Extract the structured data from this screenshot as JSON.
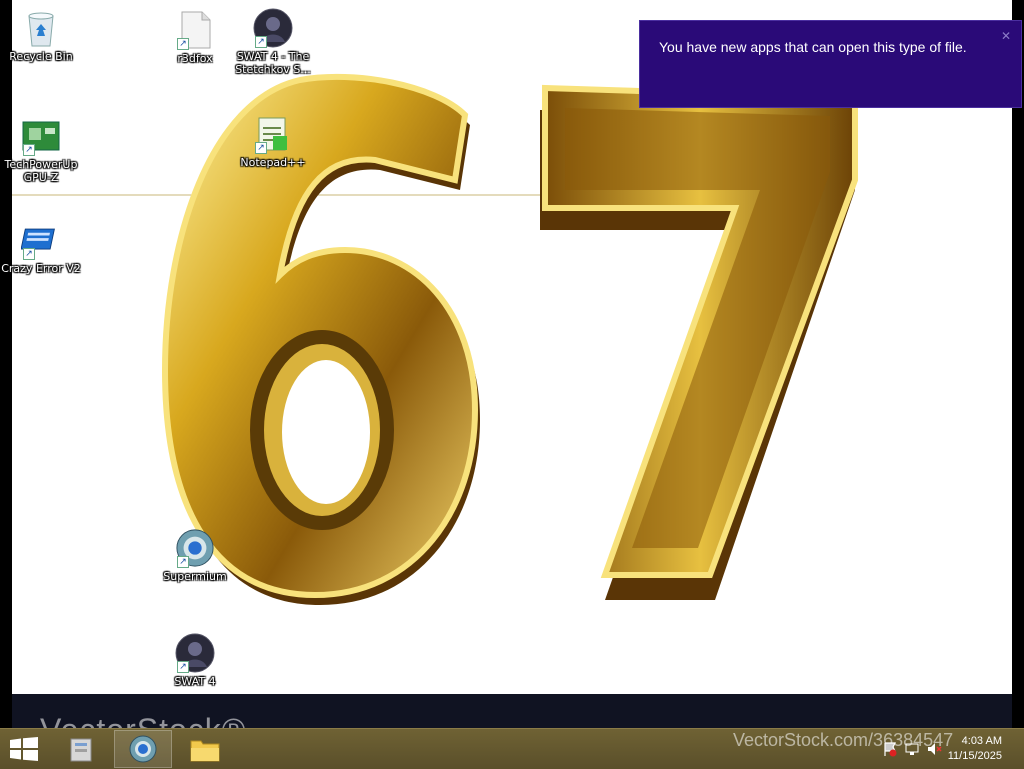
{
  "desktop": {
    "icons": [
      {
        "label": "Recycle Bin",
        "icon": "recycle-bin-icon"
      },
      {
        "label": "r3dfox",
        "icon": "file-icon"
      },
      {
        "label": "SWAT 4 - The\nStetchkov S...",
        "icon": "swat-icon"
      },
      {
        "label": "TechPowerUp\nGPU-Z",
        "icon": "gpuz-icon"
      },
      {
        "label": "Notepad++",
        "icon": "notepad-icon"
      },
      {
        "label": "Crazy Error V2",
        "icon": "crazy-error-icon"
      },
      {
        "label": "Supermium",
        "icon": "supermium-icon"
      },
      {
        "label": "SWAT 4",
        "icon": "swat-icon"
      }
    ]
  },
  "wallpaper": {
    "number_text": "67"
  },
  "toast": {
    "message": "You have new apps that can open this type of file."
  },
  "taskbar": {
    "start_icon": "windows-logo-icon",
    "pinned": [
      {
        "name": "file-manager",
        "icon": "file-manager-icon"
      },
      {
        "name": "supermium",
        "icon": "supermium-icon"
      },
      {
        "name": "explorer",
        "icon": "folder-icon"
      }
    ],
    "tray": {
      "time": "4:03 AM",
      "date": "11/15/2025"
    }
  },
  "watermark": {
    "left": "VectorStock®",
    "right": "VectorStock.com/36384547"
  },
  "colors": {
    "toast_bg": "#2a0a78",
    "taskbar_bg": "#6f6234",
    "gold": "#d6a92b"
  }
}
